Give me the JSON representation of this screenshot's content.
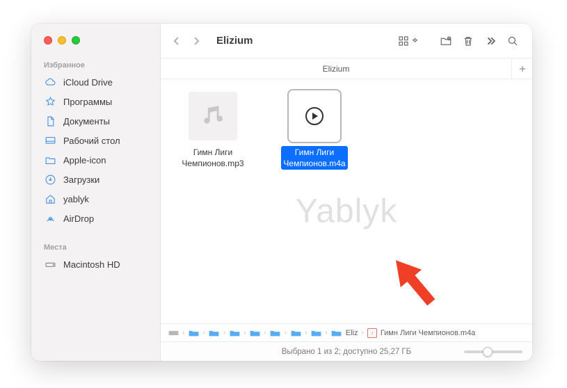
{
  "window": {
    "title": "Elizium"
  },
  "sidebar": {
    "section_favorites": "Избранное",
    "section_places": "Места",
    "items": {
      "icloud": "iCloud Drive",
      "apps": "Программы",
      "docs": "Документы",
      "desktop": "Рабочий стол",
      "appleicon": "Apple-icon",
      "downloads": "Загрузки",
      "yablyk": "yablyk",
      "airdrop": "AirDrop",
      "macintosh": "Macintosh HD"
    }
  },
  "tab": {
    "name": "Elizium"
  },
  "files": {
    "mp3": {
      "line1": "Гимн Лиги",
      "line2": "Чемпионов.mp3"
    },
    "m4a": {
      "line1": "Гимн Лиги",
      "line2": "Чемпионов.m4a"
    }
  },
  "pathbar": {
    "folder_short": "Eliz",
    "file": "Гимн Лиги Чемпионов.m4a"
  },
  "status": {
    "text": "Выбрано 1 из 2; доступно 25,27 ГБ"
  },
  "watermark": "Yablyk"
}
